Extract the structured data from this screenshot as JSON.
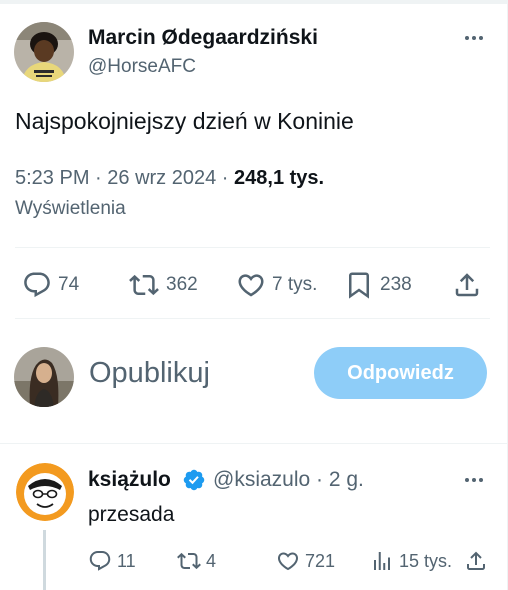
{
  "tweet": {
    "author": {
      "name": "Marcin Ødegaardziński",
      "handle": "@HorseAFC",
      "avatar": "user-avatar-photo"
    },
    "text": "Najspokojniejszy dzień w Koninie",
    "time": "5:23 PM",
    "date": "26 wrz 2024",
    "views": "248,1 tys.",
    "views_label": "Wyświetlenia",
    "stats": {
      "replies": "74",
      "retweets": "362",
      "likes": "7 tys.",
      "bookmarks": "238"
    }
  },
  "composer": {
    "placeholder": "Opublikuj",
    "button_label": "Odpowiedz",
    "button_color": "#8ecdf8"
  },
  "reply": {
    "author": {
      "name": "książulo",
      "handle": "@ksiazulo",
      "time": "2 g.",
      "verified": true
    },
    "text": "przesada",
    "stats": {
      "replies": "11",
      "retweets": "4",
      "likes": "721",
      "views": "15 tys."
    }
  },
  "colors": {
    "text": "#0f1419",
    "muted": "#536471",
    "verified": "#1d9bf0",
    "divider": "#eff3f4"
  },
  "icons": [
    "more-icon",
    "reply-icon",
    "retweet-icon",
    "like-icon",
    "bookmark-icon",
    "share-icon",
    "verified-icon",
    "views-icon"
  ]
}
